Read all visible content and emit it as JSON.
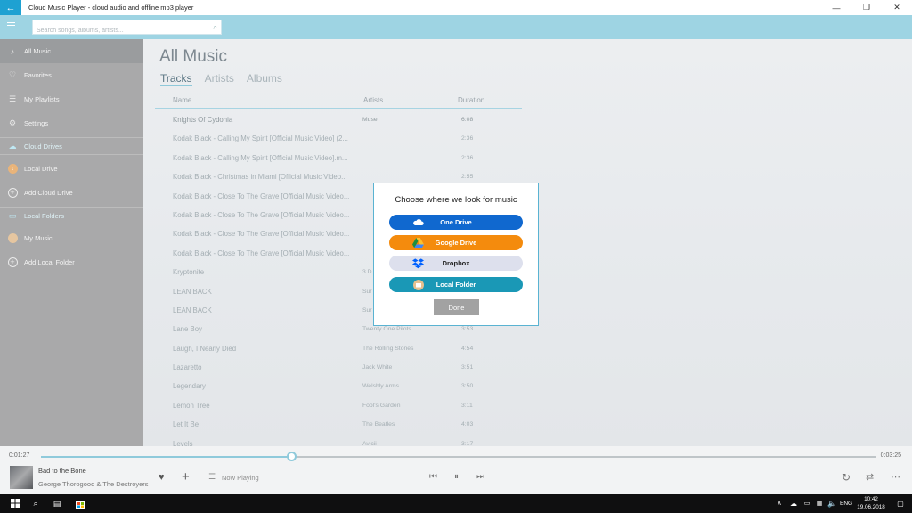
{
  "window": {
    "title": "Cloud Music Player - cloud audio and offline mp3 player",
    "minimize": "—",
    "maximize": "❐",
    "close": "✕"
  },
  "search": {
    "placeholder": "Search songs, albums, artists..."
  },
  "sidebar": {
    "items": [
      {
        "label": "All Music",
        "icon": "music-note-icon"
      },
      {
        "label": "Favorites",
        "icon": "heart-icon"
      },
      {
        "label": "My Playlists",
        "icon": "playlist-icon"
      },
      {
        "label": "Settings",
        "icon": "gear-icon"
      }
    ],
    "cloud_section": "Cloud Drives",
    "cloud_items": [
      {
        "label": "Local Drive",
        "icon": "drive-icon"
      },
      {
        "label": "Add Cloud Drive",
        "icon": "plus-icon"
      }
    ],
    "local_section": "Local Folders",
    "local_items": [
      {
        "label": "My Music",
        "icon": "folder-icon"
      },
      {
        "label": "Add Local Folder",
        "icon": "plus-icon"
      }
    ]
  },
  "main": {
    "title": "All Music",
    "tabs": [
      "Tracks",
      "Artists",
      "Albums"
    ],
    "columns": {
      "name": "Name",
      "artist": "Artists",
      "duration": "Duration"
    },
    "rows": [
      {
        "name": "Knights Of Cydonia",
        "artist": "Muse",
        "duration": "6:08"
      },
      {
        "name": "Kodak Black - Calling My Spirit [Official Music Video] (2...",
        "artist": "",
        "duration": "2:36"
      },
      {
        "name": "Kodak Black - Calling My Spirit [Official Music Video].m...",
        "artist": "",
        "duration": "2:36"
      },
      {
        "name": "Kodak Black - Christmas in Miami [Official Music Video...",
        "artist": "",
        "duration": "2:55"
      },
      {
        "name": "Kodak Black - Close To The Grave [Official Music Video...",
        "artist": "",
        "duration": ""
      },
      {
        "name": "Kodak Black - Close To The Grave [Official Music Video...",
        "artist": "",
        "duration": ""
      },
      {
        "name": "Kodak Black - Close To The Grave [Official Music Video...",
        "artist": "",
        "duration": ""
      },
      {
        "name": "Kodak Black - Close To The Grave [Official Music Video...",
        "artist": "",
        "duration": ""
      },
      {
        "name": "Kryptonite",
        "artist": "3 D",
        "duration": ""
      },
      {
        "name": "LEAN BACK",
        "artist": "Sur",
        "duration": ""
      },
      {
        "name": "LEAN BACK",
        "artist": "Sur",
        "duration": ""
      },
      {
        "name": "Lane Boy",
        "artist": "Twenty One Pilots",
        "duration": "3:53"
      },
      {
        "name": "Laugh, I Nearly Died",
        "artist": "The Rolling Stones",
        "duration": "4:54"
      },
      {
        "name": "Lazaretto",
        "artist": "Jack White",
        "duration": "3:51"
      },
      {
        "name": "Legendary",
        "artist": "Welshly Arms",
        "duration": "3:50"
      },
      {
        "name": "Lemon Tree",
        "artist": "Fool's Garden",
        "duration": "3:11"
      },
      {
        "name": "Let It Be",
        "artist": "The Beatles",
        "duration": "4:03"
      },
      {
        "name": "Levels",
        "artist": "Avicii",
        "duration": "3:17"
      }
    ]
  },
  "dialog": {
    "title": "Choose where we look for music",
    "buttons": [
      {
        "label": "One Drive",
        "icon": "onedrive-icon",
        "color": "#1068cf"
      },
      {
        "label": "Google Drive",
        "icon": "google-drive-icon",
        "color": "#f48b0d"
      },
      {
        "label": "Dropbox",
        "icon": "dropbox-icon",
        "color": "#dde0ed"
      },
      {
        "label": "Local Folder",
        "icon": "folder-icon",
        "color": "#1a98b6"
      }
    ],
    "done": "Done"
  },
  "player": {
    "elapsed": "0:01:27",
    "total": "0:03:25",
    "progress_fraction": 0.3,
    "track_title": "Bad to the Bone",
    "track_artist": "George Thorogood & The Destroyers",
    "now_playing": "Now Playing"
  },
  "taskbar": {
    "language": "ENG",
    "time": "10:42",
    "date": "19.06.2018"
  }
}
